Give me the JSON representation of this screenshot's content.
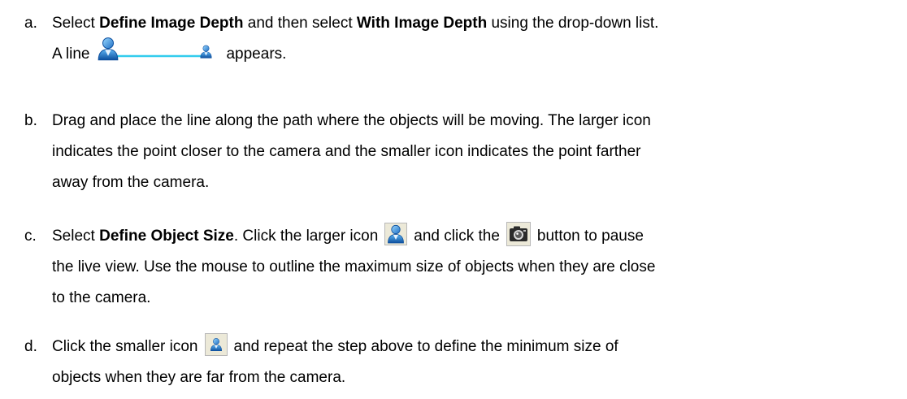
{
  "steps": [
    {
      "letter": "a.",
      "parts": {
        "t1": "Select ",
        "b1": "Define Image Depth",
        "t2": " and then select ",
        "b2": "With Image Depth",
        "t3": " using the drop-down list.",
        "t4": "A line",
        "t5": "appears."
      }
    },
    {
      "letter": "b.",
      "lines": [
        "Drag and place the line along the path where the objects will be moving. The larger icon",
        "indicates the point closer to the camera and the smaller icon indicates the point farther",
        "away from the camera."
      ]
    },
    {
      "letter": "c.",
      "parts": {
        "t1": "Select ",
        "b1": "Define Object Size",
        "t2": ". Click the larger icon",
        "t3": "and click the",
        "t4": "button to pause",
        "l2": "the live view. Use the mouse to outline the maximum size of objects when they are close",
        "l3": "to the camera."
      }
    },
    {
      "letter": "d.",
      "parts": {
        "t1": "Click the smaller icon",
        "t2": "and repeat the step above to define the minimum size of",
        "l2": "objects when they are far from the camera."
      }
    }
  ],
  "icons": {
    "person_large": "person-large-icon",
    "person_small": "person-small-icon",
    "camera": "camera-snapshot-icon",
    "depth_line_color": "#33ccee",
    "person_body_color": "#1f6fc4",
    "person_head_color": "#2c8fe0"
  }
}
